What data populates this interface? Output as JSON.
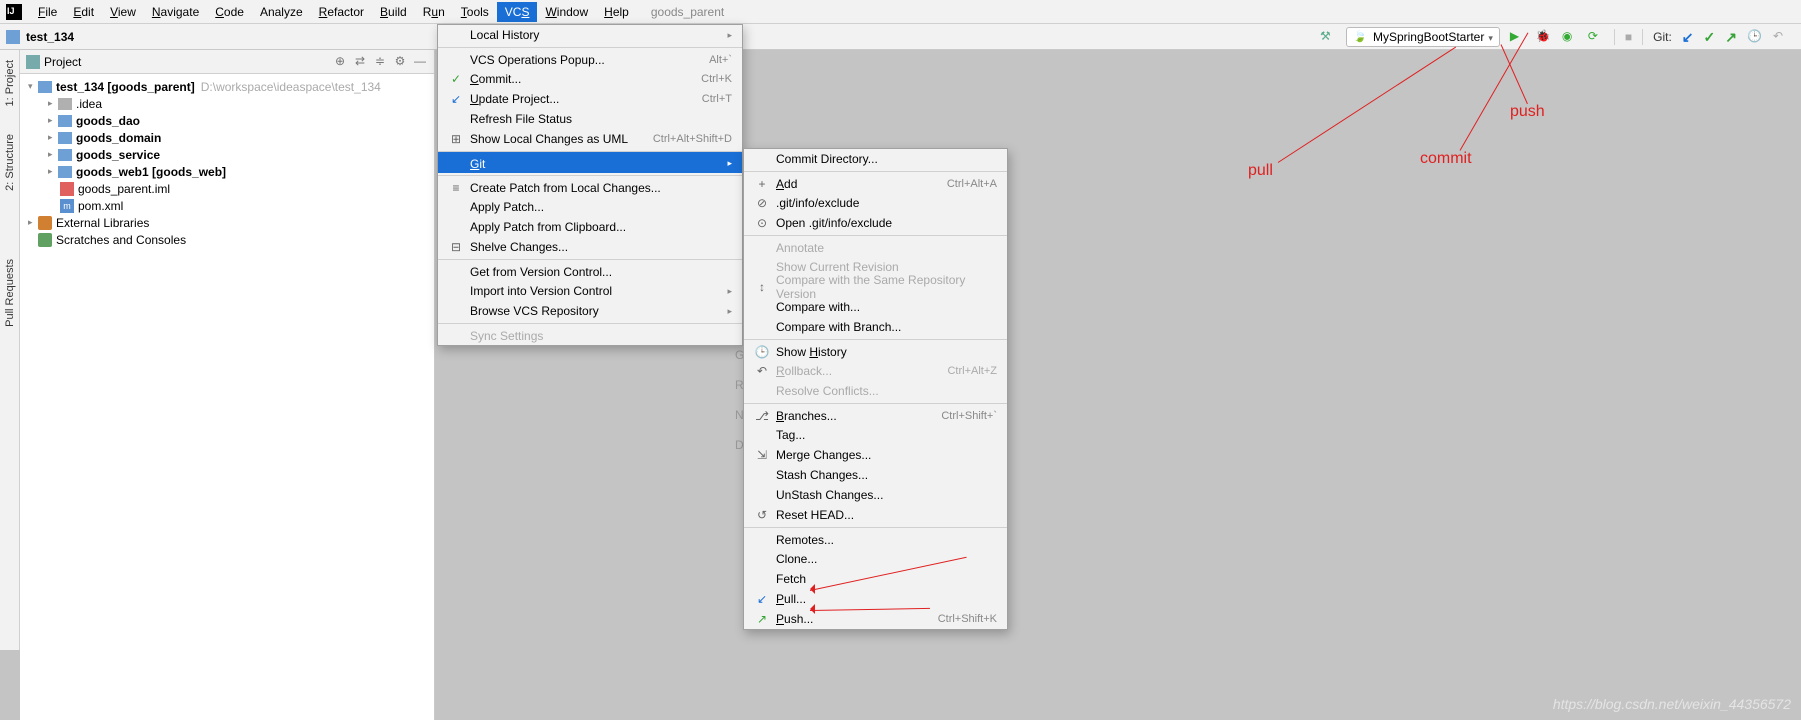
{
  "menubar": {
    "items": [
      "File",
      "Edit",
      "View",
      "Navigate",
      "Code",
      "Analyze",
      "Refactor",
      "Build",
      "Run",
      "Tools",
      "VCS",
      "Window",
      "Help"
    ],
    "mnemonics": [
      "F",
      "E",
      "V",
      "N",
      "C",
      "",
      "R",
      "B",
      "u",
      "T",
      "S",
      "W",
      "H"
    ],
    "active_index": 10,
    "context": "goods_parent"
  },
  "breadcrumb": {
    "project": "test_134"
  },
  "toolbar_right": {
    "run_config": "MySpringBootStarter",
    "git_label": "Git:"
  },
  "sidebar_tabs": [
    "1: Project",
    "2: Structure",
    "Pull Requests"
  ],
  "project_panel": {
    "title": "Project",
    "tree": {
      "root": {
        "name": "test_134",
        "bracket": "[goods_parent]",
        "path": "D:\\workspace\\ideaspace\\test_134"
      },
      "children": [
        {
          "name": ".idea",
          "bold": false,
          "color": "gray"
        },
        {
          "name": "goods_dao",
          "bold": true,
          "color": "blue"
        },
        {
          "name": "goods_domain",
          "bold": true,
          "color": "blue"
        },
        {
          "name": "goods_service",
          "bold": true,
          "color": "blue"
        },
        {
          "name": "goods_web1",
          "bracket": "[goods_web]",
          "bold": true,
          "color": "blue"
        },
        {
          "name": "goods_parent.iml",
          "type": "iml"
        },
        {
          "name": "pom.xml",
          "type": "pom"
        }
      ],
      "ext_lib": "External Libraries",
      "scratches": "Scratches and Consoles"
    }
  },
  "vcs_menu": [
    {
      "label": "Local History",
      "sub": true
    },
    {
      "label": "VCS Operations Popup...",
      "short": "Alt+`",
      "sep": true
    },
    {
      "label": "Commit...",
      "short": "Ctrl+K",
      "icon": "✓",
      "iconColor": "#35a335"
    },
    {
      "label": "Update Project...",
      "short": "Ctrl+T",
      "icon": "↙",
      "iconColor": "#1a6fd6"
    },
    {
      "label": "Refresh File Status"
    },
    {
      "label": "Show Local Changes as UML",
      "short": "Ctrl+Alt+Shift+D",
      "icon": "⊞"
    },
    {
      "label": "Git",
      "sub": true,
      "highlight": true,
      "sep": true
    },
    {
      "label": "Create Patch from Local Changes...",
      "icon": "≡",
      "sep": true
    },
    {
      "label": "Apply Patch..."
    },
    {
      "label": "Apply Patch from Clipboard..."
    },
    {
      "label": "Shelve Changes...",
      "icon": "⊟"
    },
    {
      "label": "Get from Version Control...",
      "sep": true
    },
    {
      "label": "Import into Version Control",
      "sub": true
    },
    {
      "label": "Browse VCS Repository",
      "sub": true
    },
    {
      "label": "Sync Settings",
      "disabled": true,
      "sep": true
    }
  ],
  "git_menu": [
    {
      "label": "Commit Directory..."
    },
    {
      "label": "Add",
      "short": "Ctrl+Alt+A",
      "icon": "+",
      "sep": true
    },
    {
      "label": ".git/info/exclude",
      "icon": "⊘"
    },
    {
      "label": "Open .git/info/exclude",
      "icon": "⊙"
    },
    {
      "label": "Annotate",
      "disabled": true,
      "sep": true
    },
    {
      "label": "Show Current Revision",
      "disabled": true
    },
    {
      "label": "Compare with the Same Repository Version",
      "disabled": true,
      "icon": "↕"
    },
    {
      "label": "Compare with..."
    },
    {
      "label": "Compare with Branch..."
    },
    {
      "label": "Show History",
      "icon": "🕒",
      "sep": true
    },
    {
      "label": "Rollback...",
      "short": "Ctrl+Alt+Z",
      "disabled": true,
      "icon": "↶"
    },
    {
      "label": "Resolve Conflicts...",
      "disabled": true
    },
    {
      "label": "Branches...",
      "short": "Ctrl+Shift+`",
      "icon": "⎇",
      "sep": true
    },
    {
      "label": "Tag..."
    },
    {
      "label": "Merge Changes...",
      "icon": "⇲"
    },
    {
      "label": "Stash Changes..."
    },
    {
      "label": "UnStash Changes..."
    },
    {
      "label": "Reset HEAD...",
      "icon": "↺"
    },
    {
      "label": "Remotes...",
      "sep": true
    },
    {
      "label": "Clone..."
    },
    {
      "label": "Fetch"
    },
    {
      "label": "Pull...",
      "icon": "↙",
      "iconColor": "#1a6fd6"
    },
    {
      "label": "Push...",
      "short": "Ctrl+Shift+K",
      "icon": "↗",
      "iconColor": "#35a335"
    }
  ],
  "annotations": {
    "pull": "pull",
    "commit": "commit",
    "push": "push"
  },
  "bg_letters": [
    "G",
    "R",
    "N",
    "D"
  ],
  "watermark": "https://blog.csdn.net/weixin_44356572"
}
